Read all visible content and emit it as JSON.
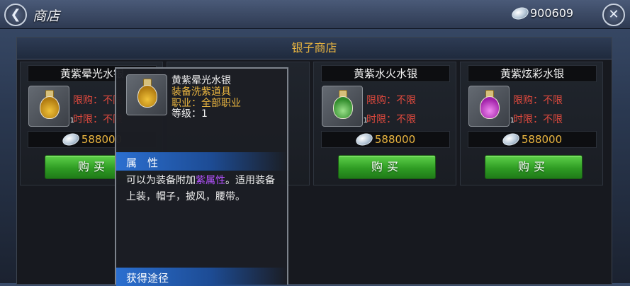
{
  "header": {
    "back_icon": "back-arrow-icon",
    "title": "商店",
    "currency_icon": "silver-ingot-icon",
    "silver_amount": "900609",
    "close_icon": "close-x-icon"
  },
  "shop": {
    "title": "银子商店",
    "items": [
      {
        "name": "黄紫晕光水银",
        "limit_buy_label": "限购：",
        "limit_buy_value": "不限",
        "limit_time_label": "时限：",
        "limit_time_value": "不限",
        "quantity": "1",
        "price": "588000",
        "buy_label": "购买",
        "potion_color": "#e0b020"
      },
      {
        "name": "黄紫水火水银",
        "limit_buy_label": "限购：",
        "limit_buy_value": "不限",
        "limit_time_label": "时限：",
        "limit_time_value": "不限",
        "quantity": "1",
        "price": "588000",
        "buy_label": "购买",
        "potion_color": "#3ea83a"
      },
      {
        "name": "黄紫炫彩水银",
        "limit_buy_label": "限购：",
        "limit_buy_value": "不限",
        "limit_time_label": "时限：",
        "limit_time_value": "不限",
        "quantity": "1",
        "price": "588000",
        "buy_label": "购买",
        "potion_color": "#c431c9"
      }
    ]
  },
  "tooltip": {
    "item_name": "黄紫晕光水银",
    "item_type": "装备洗紫道具",
    "job": "职业：全部职业",
    "level": "等级：1",
    "attr_header": "属　性",
    "desc_pre": "可以为装备附加",
    "desc_highlight": "紫属性",
    "desc_post": "。适用装备上装，帽子，披风，腰带。",
    "source_header": "获得途径"
  },
  "colors": {
    "gold_text": "#ebb640",
    "limit_red": "#e14a3e",
    "buy_green": "#2f9c24",
    "purple_highlight": "#b452ff"
  }
}
